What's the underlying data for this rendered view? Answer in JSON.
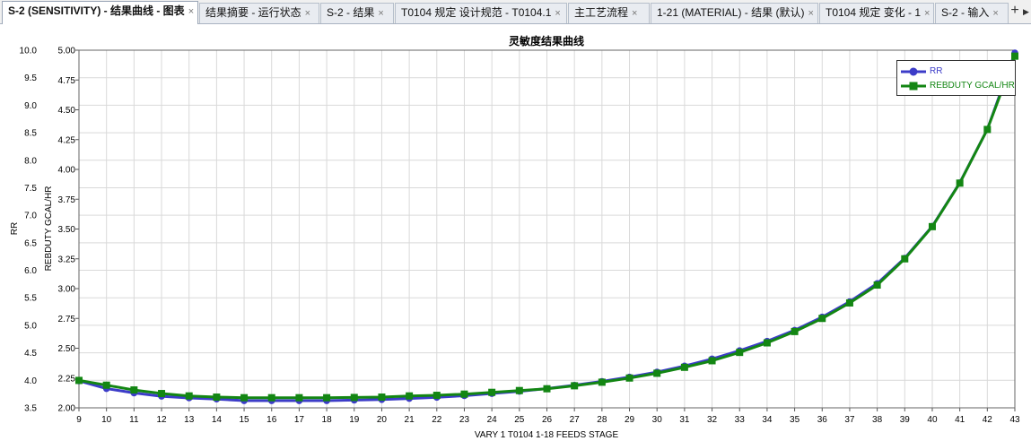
{
  "tabs": [
    {
      "label": "S-2 (SENSITIVITY) - 结果曲线 - 图表",
      "active": true
    },
    {
      "label": "结果摘要 - 运行状态",
      "active": false
    },
    {
      "label": "S-2 - 结果",
      "active": false
    },
    {
      "label": "T0104 规定 设计规范 - T0104.1",
      "active": false
    },
    {
      "label": "主工艺流程",
      "active": false
    },
    {
      "label": "1-21 (MATERIAL) - 结果 (默认)",
      "active": false
    },
    {
      "label": "T0104 规定 变化 - 1",
      "active": false
    },
    {
      "label": "S-2 - 输入",
      "active": false
    }
  ],
  "tab_close_glyph": "×",
  "tab_add_glyph": "+",
  "tab_more_glyph": "▶",
  "chart_data": {
    "type": "line",
    "title": "灵敏度结果曲线",
    "xlabel": "VARY   1 T0104 1-18 FEEDS STAGE",
    "ylabel_left": "RR",
    "ylabel_right": "REBDUTY GCAL/HR",
    "x": [
      9,
      10,
      11,
      12,
      13,
      14,
      15,
      16,
      17,
      18,
      19,
      20,
      21,
      22,
      23,
      24,
      25,
      26,
      27,
      28,
      29,
      30,
      31,
      32,
      33,
      34,
      35,
      36,
      37,
      38,
      39,
      40,
      41,
      42,
      43
    ],
    "xlim": [
      9,
      43
    ],
    "ylim_left": [
      3.5,
      10.0
    ],
    "yticks_left": [
      "3.5",
      "4.0",
      "4.5",
      "5.0",
      "5.5",
      "6.0",
      "6.5",
      "7.0",
      "7.5",
      "8.0",
      "8.5",
      "9.0",
      "9.5",
      "10.0"
    ],
    "ylim_right": [
      2.0,
      5.0
    ],
    "yticks_right": [
      "2.00",
      "2.25",
      "2.50",
      "2.75",
      "3.00",
      "3.25",
      "3.50",
      "3.75",
      "4.00",
      "4.25",
      "4.50",
      "4.75",
      "5.00"
    ],
    "grid": true,
    "legend_position": "top-right",
    "series": [
      {
        "name": "RR",
        "axis": "left",
        "color": "#3c3cc8",
        "marker": "circle",
        "values": [
          3.99,
          3.85,
          3.77,
          3.71,
          3.68,
          3.66,
          3.63,
          3.63,
          3.63,
          3.63,
          3.64,
          3.65,
          3.67,
          3.69,
          3.72,
          3.76,
          3.8,
          3.85,
          3.91,
          3.98,
          4.06,
          4.15,
          4.26,
          4.39,
          4.54,
          4.71,
          4.91,
          5.15,
          5.43,
          5.76,
          6.22,
          6.8,
          7.59,
          8.56,
          9.95
        ]
      },
      {
        "name": "REBDUTY GCAL/HR",
        "axis": "right",
        "color": "#138613",
        "marker": "square",
        "values": [
          2.23,
          2.19,
          2.15,
          2.12,
          2.1,
          2.09,
          2.085,
          2.085,
          2.085,
          2.085,
          2.087,
          2.09,
          2.1,
          2.105,
          2.115,
          2.13,
          2.145,
          2.16,
          2.185,
          2.215,
          2.25,
          2.29,
          2.34,
          2.395,
          2.465,
          2.545,
          2.64,
          2.75,
          2.88,
          3.03,
          3.25,
          3.52,
          3.885,
          4.335,
          4.95
        ]
      }
    ]
  }
}
